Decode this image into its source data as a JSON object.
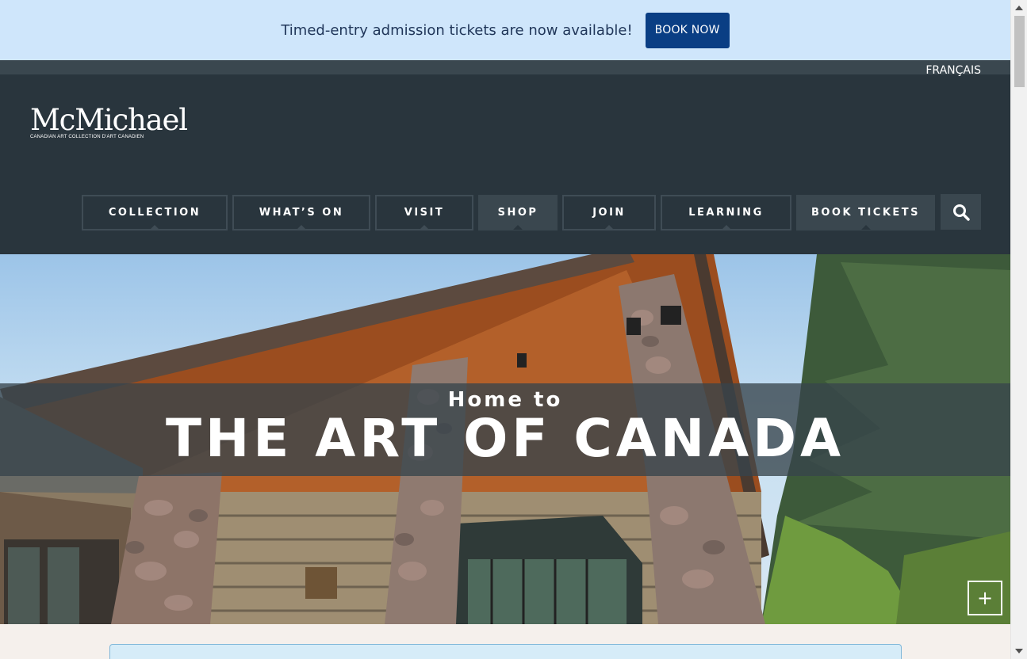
{
  "announcement": {
    "text": "Timed-entry admission tickets are now available!",
    "button_label": "BOOK NOW"
  },
  "header": {
    "language_link": "FRANÇAIS",
    "logo": {
      "name": "McMichael",
      "tagline": "CANADIAN ART COLLECTION D'ART CANADIEN"
    },
    "nav": [
      {
        "label": "COLLECTION"
      },
      {
        "label": "WHAT’S ON"
      },
      {
        "label": "VISIT"
      },
      {
        "label": "SHOP"
      },
      {
        "label": "JOIN"
      },
      {
        "label": "LEARNING"
      },
      {
        "label": "BOOK TICKETS"
      }
    ],
    "search_icon": "search-icon"
  },
  "hero": {
    "kicker": "Home to",
    "title": "THE ART OF CANADA",
    "expand_label": "+"
  },
  "colors": {
    "announcement_bg": "#cfe6fb",
    "button_blue": "#0a3e84",
    "header_bg": "#29353d",
    "nav_filled": "#3a474f"
  }
}
